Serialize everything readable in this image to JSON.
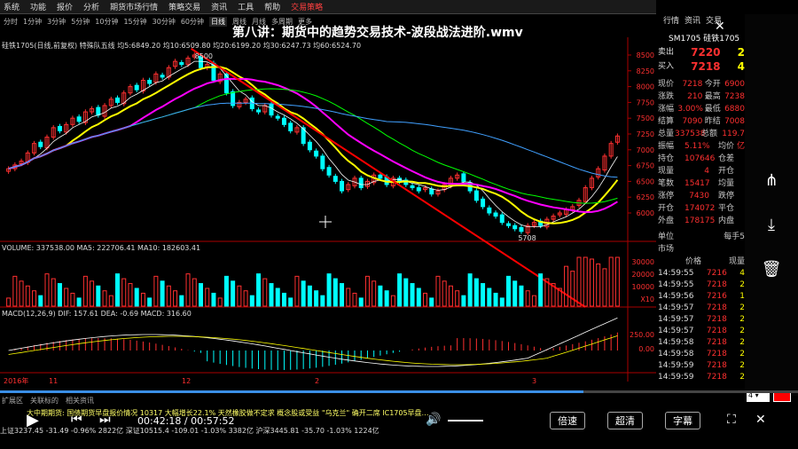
{
  "video_title": "第八讲：期货中的趋势交易技术-波段战法进阶.wmv",
  "menu": [
    "系统",
    "功能",
    "报价",
    "分析",
    "期货市场行情",
    "策略交易",
    "资讯",
    "工具",
    "帮助"
  ],
  "menu_highlight": "交易策略",
  "menu_right": [
    "行情",
    "资讯",
    "交易"
  ],
  "toolbar": {
    "items": [
      "分时",
      "1分钟",
      "3分钟",
      "5分钟",
      "10分钟",
      "15分钟",
      "30分钟",
      "60分钟",
      "日线",
      "周线",
      "月线",
      "多周期",
      "更多"
    ],
    "active": "日线"
  },
  "symbol": "硅铁1705",
  "ma_line": "硅铁1705(日线,前复权) 特殊队五线 均5:6849.20  均10:6509.80  均20:6199.20  均30:6247.73  均60:6524.70",
  "price_labels": [
    "8500",
    "8250",
    "8000",
    "7750",
    "7500",
    "7250",
    "7000",
    "6750",
    "6500",
    "6250",
    "6000"
  ],
  "chart_marks": {
    "high": "8500",
    "low": "5708"
  },
  "volume_line": "VOLUME: 337538.00  MA5: 222706.41  MA10: 182603.41",
  "volume_labels": [
    "30000",
    "20000",
    "10000",
    "X10"
  ],
  "macd_line": "MACD(12,26,9)  DIF: 157.61  DEA: -0.69  MACD: 316.60",
  "macd_labels": [
    "250.00",
    "0.00"
  ],
  "x_labels": [
    "2016年",
    "11",
    "12",
    "2",
    "3"
  ],
  "quote_header": "SM1705 硅铁1705",
  "quote": {
    "sell": {
      "label": "卖出",
      "price": "7220",
      "vol": "2"
    },
    "buy": {
      "label": "买入",
      "price": "7218",
      "vol": "4"
    },
    "rows": [
      [
        "现价",
        "7218",
        "今开",
        "6900"
      ],
      [
        "涨跌",
        "210",
        "最高",
        "7238"
      ],
      [
        "涨幅",
        "3.00%",
        "最低",
        "6880"
      ],
      [
        "结算",
        "7090",
        "昨结",
        "7008"
      ],
      [
        "总量",
        "337538",
        "总额",
        "119.7亿"
      ],
      [
        "振幅",
        "5.11%",
        "均价",
        ""
      ],
      [
        "持仓",
        "107646",
        "仓差",
        ""
      ],
      [
        "现量",
        "4",
        "开仓",
        ""
      ],
      [
        "笔数",
        "15417",
        "均量",
        ""
      ],
      [
        "涨停",
        "7430",
        "跌停",
        ""
      ],
      [
        "开仓",
        "174072",
        "平仓",
        ""
      ],
      [
        "外盘",
        "178175",
        "内盘",
        ""
      ]
    ],
    "unit_label": "单位",
    "unit_value": "每手5",
    "market_label": "市场",
    "ticks_header": [
      "",
      "价格",
      "现量"
    ],
    "ticks": [
      [
        "14:59:55",
        "7216",
        "4"
      ],
      [
        "14:59:55",
        "7218",
        "2"
      ],
      [
        "14:59:56",
        "7216",
        "1"
      ],
      [
        "14:59:57",
        "7218",
        "2"
      ],
      [
        "14:59:57",
        "7218",
        "2"
      ],
      [
        "14:59:57",
        "7218",
        "2"
      ],
      [
        "14:59:58",
        "7218",
        "2"
      ],
      [
        "14:59:58",
        "7218",
        "2"
      ],
      [
        "14:59:59",
        "7218",
        "2"
      ],
      [
        "14:59:59",
        "7218",
        "2"
      ]
    ]
  },
  "bottom_tabs": [
    "扩展区",
    "关联标的",
    "相关资讯"
  ],
  "news": "大中期期货: 国债期货早盘报价情况 10317  大幅增长22.1%  天然橡胶做不定求  概念股或受益  \"乌克兰\" 确开二席  IC1705早盘…",
  "status": "上证3237.45  -31.49  -0.96%  2822亿  深证10515.4  -109.01  -1.03%  3382亿  沪深3445.81  -35.70  -1.03%  1224亿",
  "player": {
    "time_current": "00:42:18",
    "time_total": "00:57:52",
    "speed_label": "倍速",
    "quality_label": "超清",
    "subtitle_label": "字幕",
    "progress": 0.731
  },
  "side_select": "4",
  "colors": {
    "up": "#ff3030",
    "down": "#00ffff",
    "ma5": "#ffffff",
    "ma10": "#ffff00",
    "ma20": "#ff00ff",
    "ma30": "#00ff00",
    "ma60": "#40a0ff",
    "trend": "#ff0000"
  }
}
